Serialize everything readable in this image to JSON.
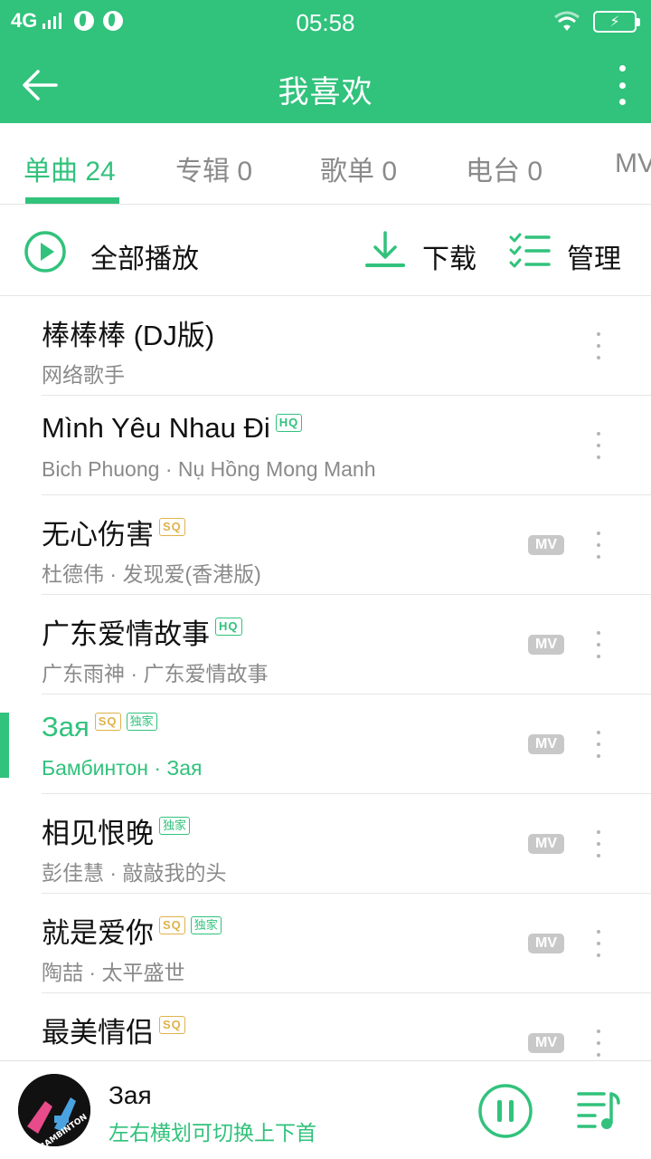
{
  "status_bar": {
    "network": "4G",
    "time": "05:58"
  },
  "header": {
    "title": "我喜欢"
  },
  "tabs": [
    {
      "label": "单曲 24",
      "active": true
    },
    {
      "label": "专辑 0",
      "active": false
    },
    {
      "label": "歌单 0",
      "active": false
    },
    {
      "label": "电台 0",
      "active": false
    },
    {
      "label": "MV",
      "active": false
    }
  ],
  "actions": {
    "play_all": "全部播放",
    "download": "下载",
    "manage": "管理"
  },
  "songs": [
    {
      "title": "棒棒棒 (DJ版)",
      "subtitle": "网络歌手",
      "badges": [],
      "mv": false
    },
    {
      "title": "Mình Yêu Nhau Đi",
      "subtitle": "Bich Phuong · Nụ Hồng Mong Manh",
      "badges": [
        "HQ"
      ],
      "mv": false
    },
    {
      "title": "无心伤害",
      "subtitle": "杜德伟 · 发现爱(香港版)",
      "badges": [
        "SQ"
      ],
      "mv": true
    },
    {
      "title": "广东爱情故事",
      "subtitle": "广东雨神 · 广东爱情故事",
      "badges": [
        "HQ"
      ],
      "mv": true
    },
    {
      "title": "Зая",
      "subtitle": "Бамбинтон · Зая",
      "badges": [
        "SQ",
        "独家"
      ],
      "mv": true,
      "playing": true
    },
    {
      "title": "相见恨晚",
      "subtitle": "彭佳慧 · 敲敲我的头",
      "badges": [
        "独家"
      ],
      "mv": true
    },
    {
      "title": "就是爱你",
      "subtitle": "陶喆 · 太平盛世",
      "badges": [
        "SQ",
        "独家"
      ],
      "mv": true
    },
    {
      "title": "最美情侣",
      "subtitle": "",
      "badges": [
        "SQ"
      ],
      "mv": true
    }
  ],
  "mv_label": "MV",
  "now_playing": {
    "title": "Зая",
    "hint": "左右横划可切换上下首",
    "cover_text": "BAMBINTON"
  },
  "colors": {
    "accent": "#31c27c",
    "sq_badge": "#e0b24b",
    "mv_badge": "#c8c8c8",
    "secondary_text": "#8a8a8a"
  }
}
